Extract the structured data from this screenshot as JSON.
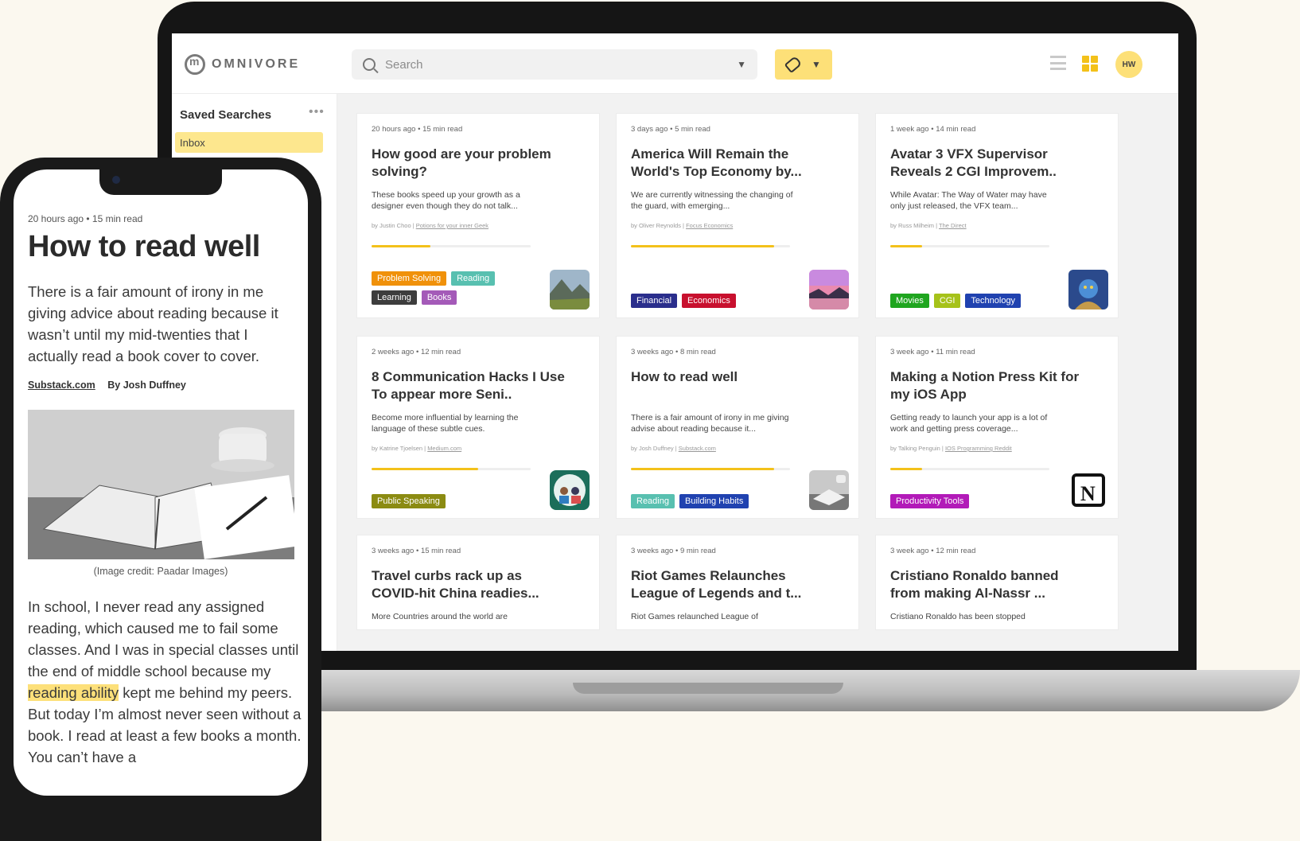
{
  "app": {
    "logo_text": "OMNIVORE",
    "search_placeholder": "Search",
    "avatar_initials": "HW",
    "colors": {
      "accent": "#f3c11a",
      "highlight": "#fde07a"
    }
  },
  "sidebar": {
    "title": "Saved Searches",
    "more": "•••",
    "items": [
      {
        "label": "Inbox",
        "selected": true
      }
    ]
  },
  "cards": [
    {
      "meta": "20 hours ago  •  15 min read",
      "title": "How good are your problem solving?",
      "desc": "These books speed up your growth as a designer even though they do not talk...",
      "author": "by Justin Choo | ",
      "source": "Potions for your inner Geek",
      "progress": 0.37,
      "tags": [
        {
          "label": "Problem Solving",
          "color": "#f0910a"
        },
        {
          "label": "Reading",
          "color": "#58c0b0"
        },
        {
          "label": "Learning",
          "color": "#3d3d3d"
        },
        {
          "label": "Books",
          "color": "#a45ab8"
        }
      ],
      "thumb": "mountain-landscape"
    },
    {
      "meta": "3 days ago  •  5 min read",
      "title": "America Will Remain the World's Top  Economy by...",
      "desc": "We are currently witnessing the changing of the guard, with emerging...",
      "author": "by Oliver Reynolds | ",
      "source": "Focus Economics",
      "progress": 0.9,
      "tags": [
        {
          "label": "Financial",
          "color": "#2a2e8c"
        },
        {
          "label": "Economics",
          "color": "#c8102e"
        }
      ],
      "thumb": "sunset-lake"
    },
    {
      "meta": "1 week ago  •  14 min read",
      "title": "Avatar 3 VFX Supervisor Reveals 2 CGI Improvem..",
      "desc": "While Avatar: The Way of Water may have only just released, the VFX team...",
      "author": "by Russ Milheim | ",
      "source": "The Direct",
      "progress": 0.2,
      "tags": [
        {
          "label": "Movies",
          "color": "#1fa51f"
        },
        {
          "label": "CGI",
          "color": "#a6c21a"
        },
        {
          "label": "Technology",
          "color": "#2042b0"
        }
      ],
      "thumb": "avatar-portrait"
    },
    {
      "meta": "2 weeks ago  •  12 min read",
      "title": "8 Communication Hacks I Use To appear more Seni..",
      "desc": "Become more influential by learning the language of these subtle cues.",
      "author": "by Katrine Tjoelsen | ",
      "source": "Medium.com",
      "progress": 0.67,
      "tags": [
        {
          "label": "Public Speaking",
          "color": "#8b8b12"
        }
      ],
      "thumb": "people-talking"
    },
    {
      "meta": "3 weeks ago  •  8 min read",
      "title": "How to read well",
      "desc": "There is a fair amount of irony in me giving advise about reading because it...",
      "author": "by Josh Duffney | ",
      "source": "Substack.com",
      "progress": 0.9,
      "tags": [
        {
          "label": "Reading",
          "color": "#58c0b0"
        },
        {
          "label": "Building Habits",
          "color": "#2042b0"
        }
      ],
      "thumb": "open-book"
    },
    {
      "meta": "3 week ago  •  11 min read",
      "title": "Making a Notion Press Kit for my iOS App",
      "desc": "Getting ready to launch your app is a lot of work and getting press coverage...",
      "author": "by Talking Penguin | ",
      "source": "IOS Programming Reddit",
      "progress": 0.2,
      "tags": [
        {
          "label": "Productivity Tools",
          "color": "#b21ab8"
        }
      ],
      "thumb": "notion-logo"
    },
    {
      "meta": "3 weeks ago  •  15 min read",
      "title": "Travel curbs rack up as COVID-hit China readies...",
      "desc": "More Countries around the world are",
      "author": "",
      "source": "",
      "progress": 0,
      "tags": [],
      "thumb": ""
    },
    {
      "meta": "3 weeks ago  •  9 min read",
      "title": "Riot Games Relaunches League of Legends and t...",
      "desc": "Riot Games relaunched League of",
      "author": "",
      "source": "",
      "progress": 0,
      "tags": [],
      "thumb": ""
    },
    {
      "meta": "3 week ago  •  12 min read",
      "title": "Cristiano Ronaldo banned from making Al-Nassr ...",
      "desc": "Cristiano Ronaldo has been stopped",
      "author": "",
      "source": "",
      "progress": 0,
      "tags": [],
      "thumb": ""
    }
  ],
  "phone": {
    "meta": "20 hours ago  •  15 min read",
    "title": "How to read well",
    "intro": "There is a fair amount of irony in me giving advice about reading because it wasn’t until my mid-twenties that I actually read a book cover to cover.",
    "source": "Substack.com",
    "author": "By Josh Duffney",
    "image": "book-and-coffee-photo",
    "caption": "(Image credit: Paadar Images)",
    "body_before": "In school, I never read any assigned reading, which caused me to fail some classes. And I was in special classes until the end of middle school because my ",
    "body_highlight": "reading ability",
    "body_after": " kept me behind my peers. But today I’m almost never seen without a book. I read at least a few books a month. You can’t have a"
  }
}
